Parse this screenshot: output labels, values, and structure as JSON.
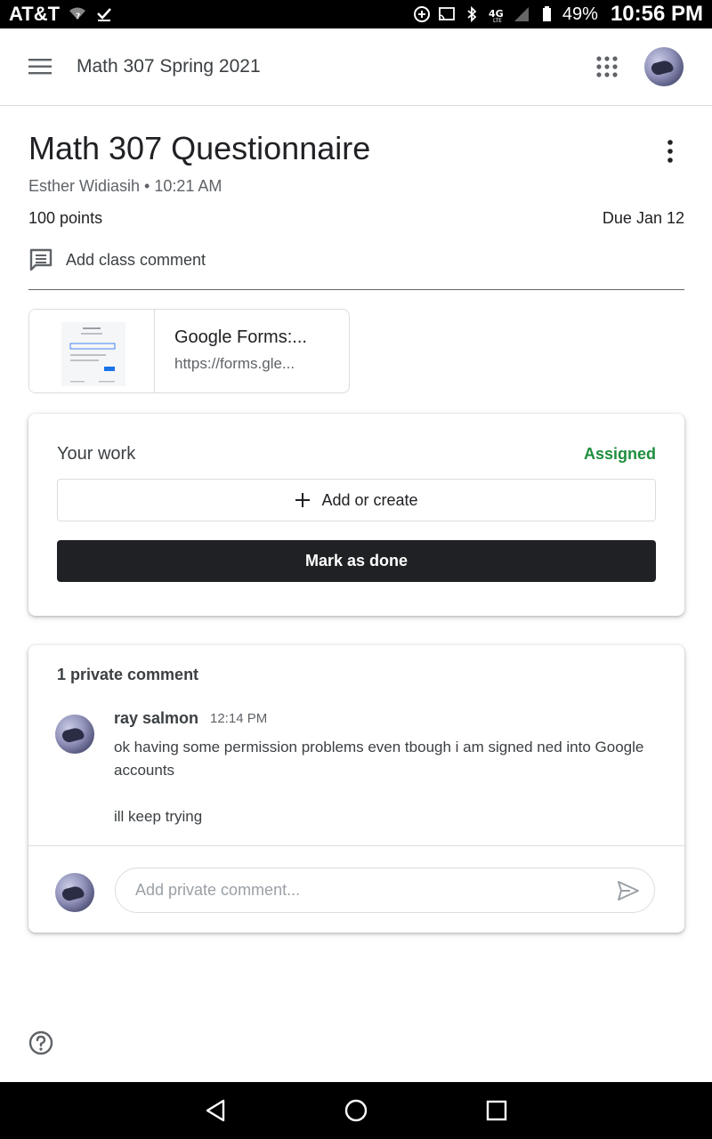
{
  "status_bar": {
    "carrier": "AT&T",
    "battery": "49%",
    "time": "10:56 PM"
  },
  "app_bar": {
    "class_title": "Math 307 Spring 2021"
  },
  "assignment": {
    "title": "Math 307 Questionnaire",
    "byline": "Esther Widiasih • 10:21 AM",
    "points": "100 points",
    "due": "Due Jan 12",
    "class_comment_label": "Add class comment"
  },
  "attachment": {
    "title": "Google Forms:...",
    "url": "https://forms.gle..."
  },
  "your_work": {
    "label": "Your work",
    "status": "Assigned",
    "status_color": "#1e8e3e",
    "add_label": "Add or create",
    "done_label": "Mark as done"
  },
  "private_comments": {
    "header": "1 private comment",
    "comments": [
      {
        "author": "ray salmon",
        "time": "12:14 PM",
        "paragraphs": [
          "ok having some permission problems even tbough i am signed ned into Google accounts",
          "ill keep trying"
        ]
      }
    ],
    "input_placeholder": "Add private comment..."
  },
  "icons": {
    "menu": "menu-icon",
    "apps": "apps-grid-icon",
    "more": "more-vert-icon",
    "comment": "comment-icon",
    "add": "plus-icon",
    "send": "send-icon",
    "help": "help-icon"
  }
}
